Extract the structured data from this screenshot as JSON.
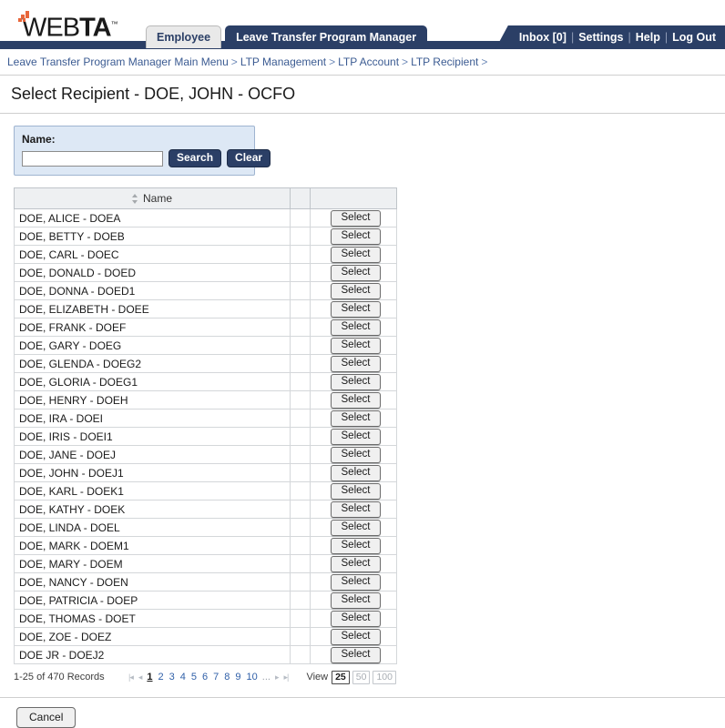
{
  "brand": {
    "name_part1": "WEB",
    "name_part2": "TA",
    "trademark": "™"
  },
  "header": {
    "tabs": [
      {
        "label": "Employee",
        "active": false
      },
      {
        "label": "Leave Transfer Program Manager",
        "active": true
      }
    ],
    "user_nav": [
      {
        "label": "Inbox [0]"
      },
      {
        "label": "Settings"
      },
      {
        "label": "Help"
      },
      {
        "label": "Log Out"
      }
    ],
    "nav_separator": "|"
  },
  "breadcrumb": {
    "separator": ">",
    "items": [
      "Leave Transfer Program Manager Main Menu",
      "LTP Management",
      "LTP Account",
      "LTP Recipient"
    ],
    "trailing_separator": ">"
  },
  "page": {
    "title": "Select Recipient - DOE, JOHN - OCFO"
  },
  "search": {
    "label": "Name:",
    "value": "",
    "placeholder": "",
    "search_button": "Search",
    "clear_button": "Clear"
  },
  "table": {
    "columns": [
      {
        "label": "Name",
        "sortable": true
      },
      {
        "label": "",
        "sortable": false
      },
      {
        "label": "",
        "sortable": false
      }
    ],
    "select_button_label": "Select",
    "rows": [
      "DOE, ALICE - DOEA",
      "DOE, BETTY - DOEB",
      "DOE, CARL - DOEC",
      "DOE, DONALD - DOED",
      "DOE, DONNA - DOED1",
      "DOE, ELIZABETH - DOEE",
      "DOE, FRANK - DOEF",
      "DOE, GARY - DOEG",
      "DOE, GLENDA - DOEG2",
      "DOE, GLORIA - DOEG1",
      "DOE, HENRY - DOEH",
      "DOE, IRA - DOEI",
      "DOE, IRIS - DOEI1",
      "DOE, JANE - DOEJ",
      "DOE, JOHN - DOEJ1",
      "DOE, KARL - DOEK1",
      "DOE, KATHY - DOEK",
      "DOE, LINDA - DOEL",
      "DOE, MARK - DOEM1",
      "DOE, MARY - DOEM",
      "DOE, NANCY - DOEN",
      "DOE, PATRICIA - DOEP",
      "DOE, THOMAS - DOET",
      "DOE, ZOE - DOEZ",
      "DOE JR - DOEJ2"
    ]
  },
  "pagination": {
    "record_summary": "1-25 of 470 Records",
    "first_arrow": "|◂",
    "prev_arrow": "◂",
    "next_arrow": "▸",
    "last_arrow": "▸|",
    "pages": [
      "1",
      "2",
      "3",
      "4",
      "5",
      "6",
      "7",
      "8",
      "9",
      "10"
    ],
    "current_page": "1",
    "ellipsis": "...",
    "view_label": "View",
    "view_options": [
      "25",
      "50",
      "100"
    ],
    "view_selected": "25"
  },
  "footer": {
    "cancel_button": "Cancel"
  },
  "colors": {
    "navy": "#2b3f66",
    "accent_orange": "#e8663a",
    "panel_blue": "#dde8f5",
    "link_blue": "#3b5b92"
  }
}
